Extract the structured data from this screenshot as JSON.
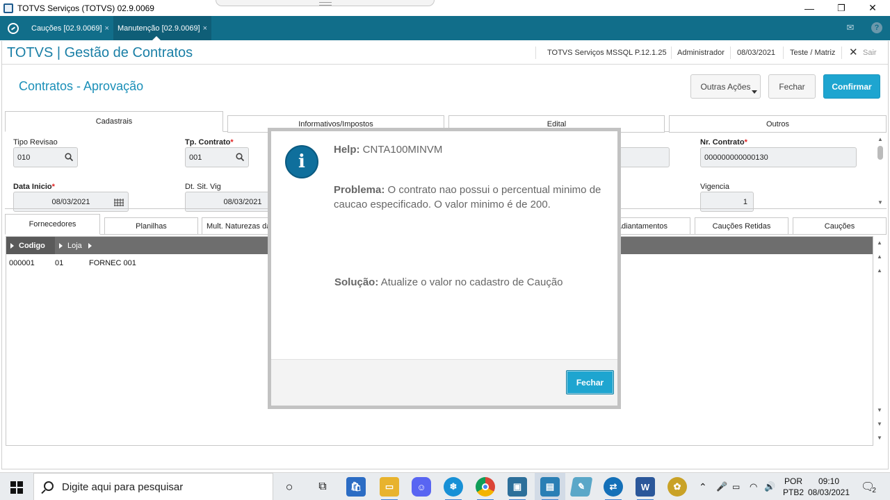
{
  "window": {
    "title": "TOTVS Serviços (TOTVS) 02.9.0069",
    "minimize": "—",
    "restore": "❐",
    "close": "✕"
  },
  "program_tabs": [
    {
      "label": "Cauções [02.9.0069]",
      "close": "×"
    },
    {
      "label": "Manutenção [02.9.0069]",
      "close": "×"
    }
  ],
  "tabs_bar_icons": {
    "mail": "✉",
    "help": "?"
  },
  "app_header": {
    "title": "TOTVS | Gestão de Contratos",
    "environment": "TOTVS Serviços MSSQL P.12.1.25",
    "user": "Administrador",
    "date": "08/03/2021",
    "branch": "Teste / Matriz",
    "exit_label": "Sair"
  },
  "page": {
    "title": "Contratos - Aprovação",
    "buttons": {
      "other_actions": "Outras Ações",
      "close": "Fechar",
      "confirm": "Confirmar"
    }
  },
  "top_tabs": [
    "Cadastrais",
    "Informativos/Impostos",
    "Edital",
    "Outros"
  ],
  "fields": {
    "tipo_revisao": {
      "label": "Tipo Revisao",
      "value": "010"
    },
    "tp_contrato": {
      "label": "Tp. Contrato",
      "required_mark": "*",
      "value": "001"
    },
    "nr_contrato": {
      "label": "Nr. Contrato",
      "required_mark": "*",
      "value": "000000000000130"
    },
    "data_inicio": {
      "label": "Data Inicio",
      "required_mark": "*",
      "value": "08/03/2021"
    },
    "dt_sit_vig": {
      "label": "Dt. Sit. Vig",
      "value": "08/03/2021"
    },
    "vigencia": {
      "label": "Vigencia",
      "value": "1"
    }
  },
  "bottom_tabs": [
    "Fornecedores",
    "Planilhas",
    "Mult. Naturezas da",
    "Adiantamentos",
    "Cauções Retidas",
    "Cauções"
  ],
  "grid": {
    "columns": [
      "Codigo",
      "Loja"
    ],
    "rows": [
      {
        "codigo": "000001",
        "loja": "01",
        "nome": "FORNEC 001"
      }
    ]
  },
  "dialog": {
    "icon": "info-icon",
    "help_label": "Help:",
    "help_code": "CNTA100MINVM",
    "problem_label": "Problema:",
    "problem_text": "O contrato nao possui o percentual minimo de caucao especificado. O valor minimo é de 200.",
    "solution_label": "Solução:",
    "solution_text": "Atualize o valor no cadastro de Caução",
    "button": "Fechar"
  },
  "taskbar": {
    "search_placeholder": "Digite aqui para pesquisar",
    "language_top": "POR",
    "language_bottom": "PTB2",
    "time": "09:10",
    "date": "08/03/2021",
    "notification_count": "2"
  }
}
